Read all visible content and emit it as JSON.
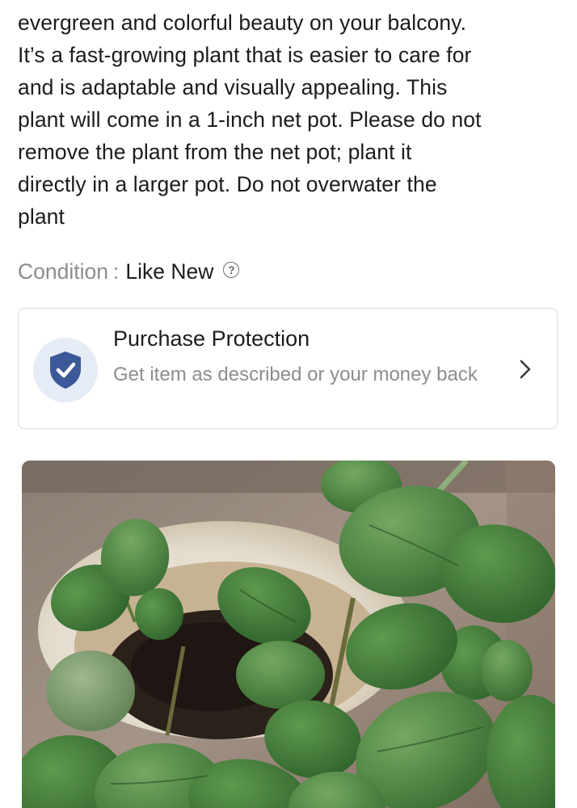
{
  "listing": {
    "description": "evergreen and colorful beauty on your balcony.\nIt’s a fast-growing plant that is easier to care for\nand is adaptable and visually appealing. This\nplant will come in a 1-inch net pot. Please do not\nremove the plant from the net pot; plant it\ndirectly in a larger pot. Do not overwater the\nplant",
    "condition_label": "Condition",
    "condition_separator": ":",
    "condition_value": "Like New",
    "info_icon_glyph": "?"
  },
  "purchase_protection": {
    "title": "Purchase Protection",
    "subtitle": "Get item as described or your money back",
    "icon": "shield-check-icon",
    "chevron_icon": "chevron-right-icon",
    "accent_color": "#3b5998",
    "icon_bg_color": "#e6ecf6"
  },
  "photo": {
    "icon": "plant-photo",
    "subject": "potted plant photo"
  },
  "colors": {
    "text_primary": "#1c1c1e",
    "text_secondary": "#8a8d91",
    "border": "#d8dade"
  }
}
